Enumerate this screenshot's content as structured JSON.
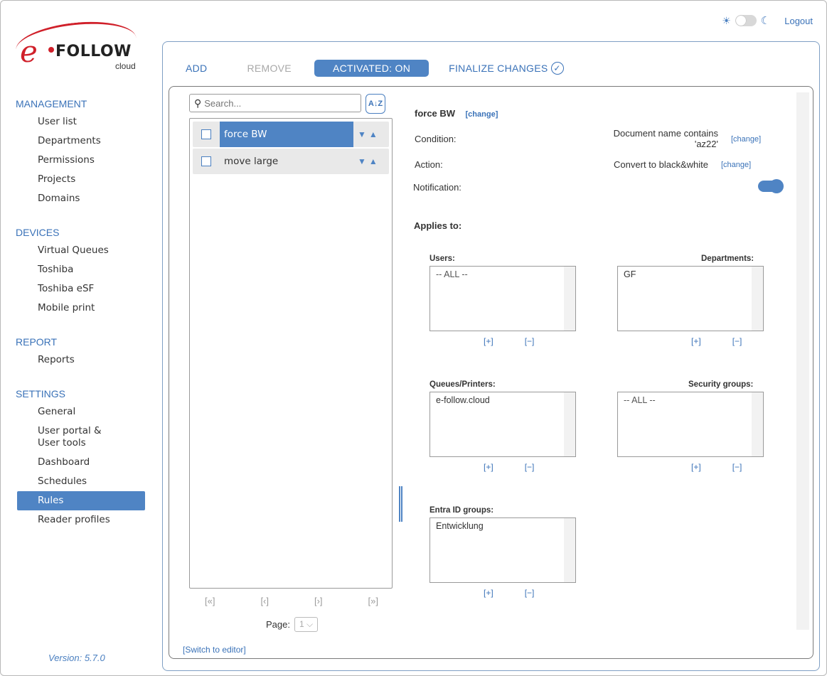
{
  "topbar": {
    "theme_light_icon": "sun-icon",
    "theme_dark_icon": "moon-icon",
    "logout": "Logout"
  },
  "logo": {
    "e": "e",
    "follow": "FOLLOW",
    "cloud": "cloud"
  },
  "sidebar": {
    "sections": [
      {
        "title": "MANAGEMENT",
        "items": [
          "User list",
          "Departments",
          "Permissions",
          "Projects",
          "Domains"
        ]
      },
      {
        "title": "DEVICES",
        "items": [
          "Virtual Queues",
          "Toshiba",
          "Toshiba eSF",
          "Mobile print"
        ]
      },
      {
        "title": "REPORT",
        "items": [
          "Reports"
        ]
      },
      {
        "title": "SETTINGS",
        "items": [
          "General",
          "User portal &\nUser tools",
          "Dashboard",
          "Schedules",
          "Rules",
          "Reader profiles"
        ]
      }
    ],
    "active_item": "Rules",
    "version": "Version: 5.7.0"
  },
  "toolbar": {
    "add": "ADD",
    "remove": "REMOVE",
    "activated": "ACTIVATED: ON",
    "finalize": "FINALIZE CHANGES"
  },
  "list": {
    "search_placeholder": "Search...",
    "sort_label": "A↓Z",
    "rows": [
      {
        "name": "force BW",
        "selected": true
      },
      {
        "name": "move large",
        "selected": false
      }
    ],
    "pager": {
      "first": "[«]",
      "prev": "[‹]",
      "next": "[›]",
      "last": "[»]"
    },
    "page_label": "Page:",
    "page_value": "1"
  },
  "detail": {
    "rule_name": "force BW",
    "change": "[change]",
    "condition_label": "Condition:",
    "condition_value_line1": "Document name contains",
    "condition_value_line2": "'az22'",
    "action_label": "Action:",
    "action_value": "Convert to black&white",
    "notification_label": "Notification:",
    "notification_on": true,
    "applies_to": "Applies to:",
    "groups": {
      "users": {
        "label": "Users:",
        "items": [
          "-- ALL --"
        ]
      },
      "departments": {
        "label": "Departments:",
        "items": [
          "GF"
        ]
      },
      "queues": {
        "label": "Queues/Printers:",
        "items": [
          "e-follow.cloud"
        ]
      },
      "security": {
        "label": "Security groups:",
        "items": [
          "-- ALL --"
        ]
      },
      "entra": {
        "label": "Entra ID groups:",
        "items": [
          "Entwicklung"
        ]
      }
    },
    "plus": "[+]",
    "minus": "[−]"
  },
  "switch_editor": "[Switch to editor]"
}
